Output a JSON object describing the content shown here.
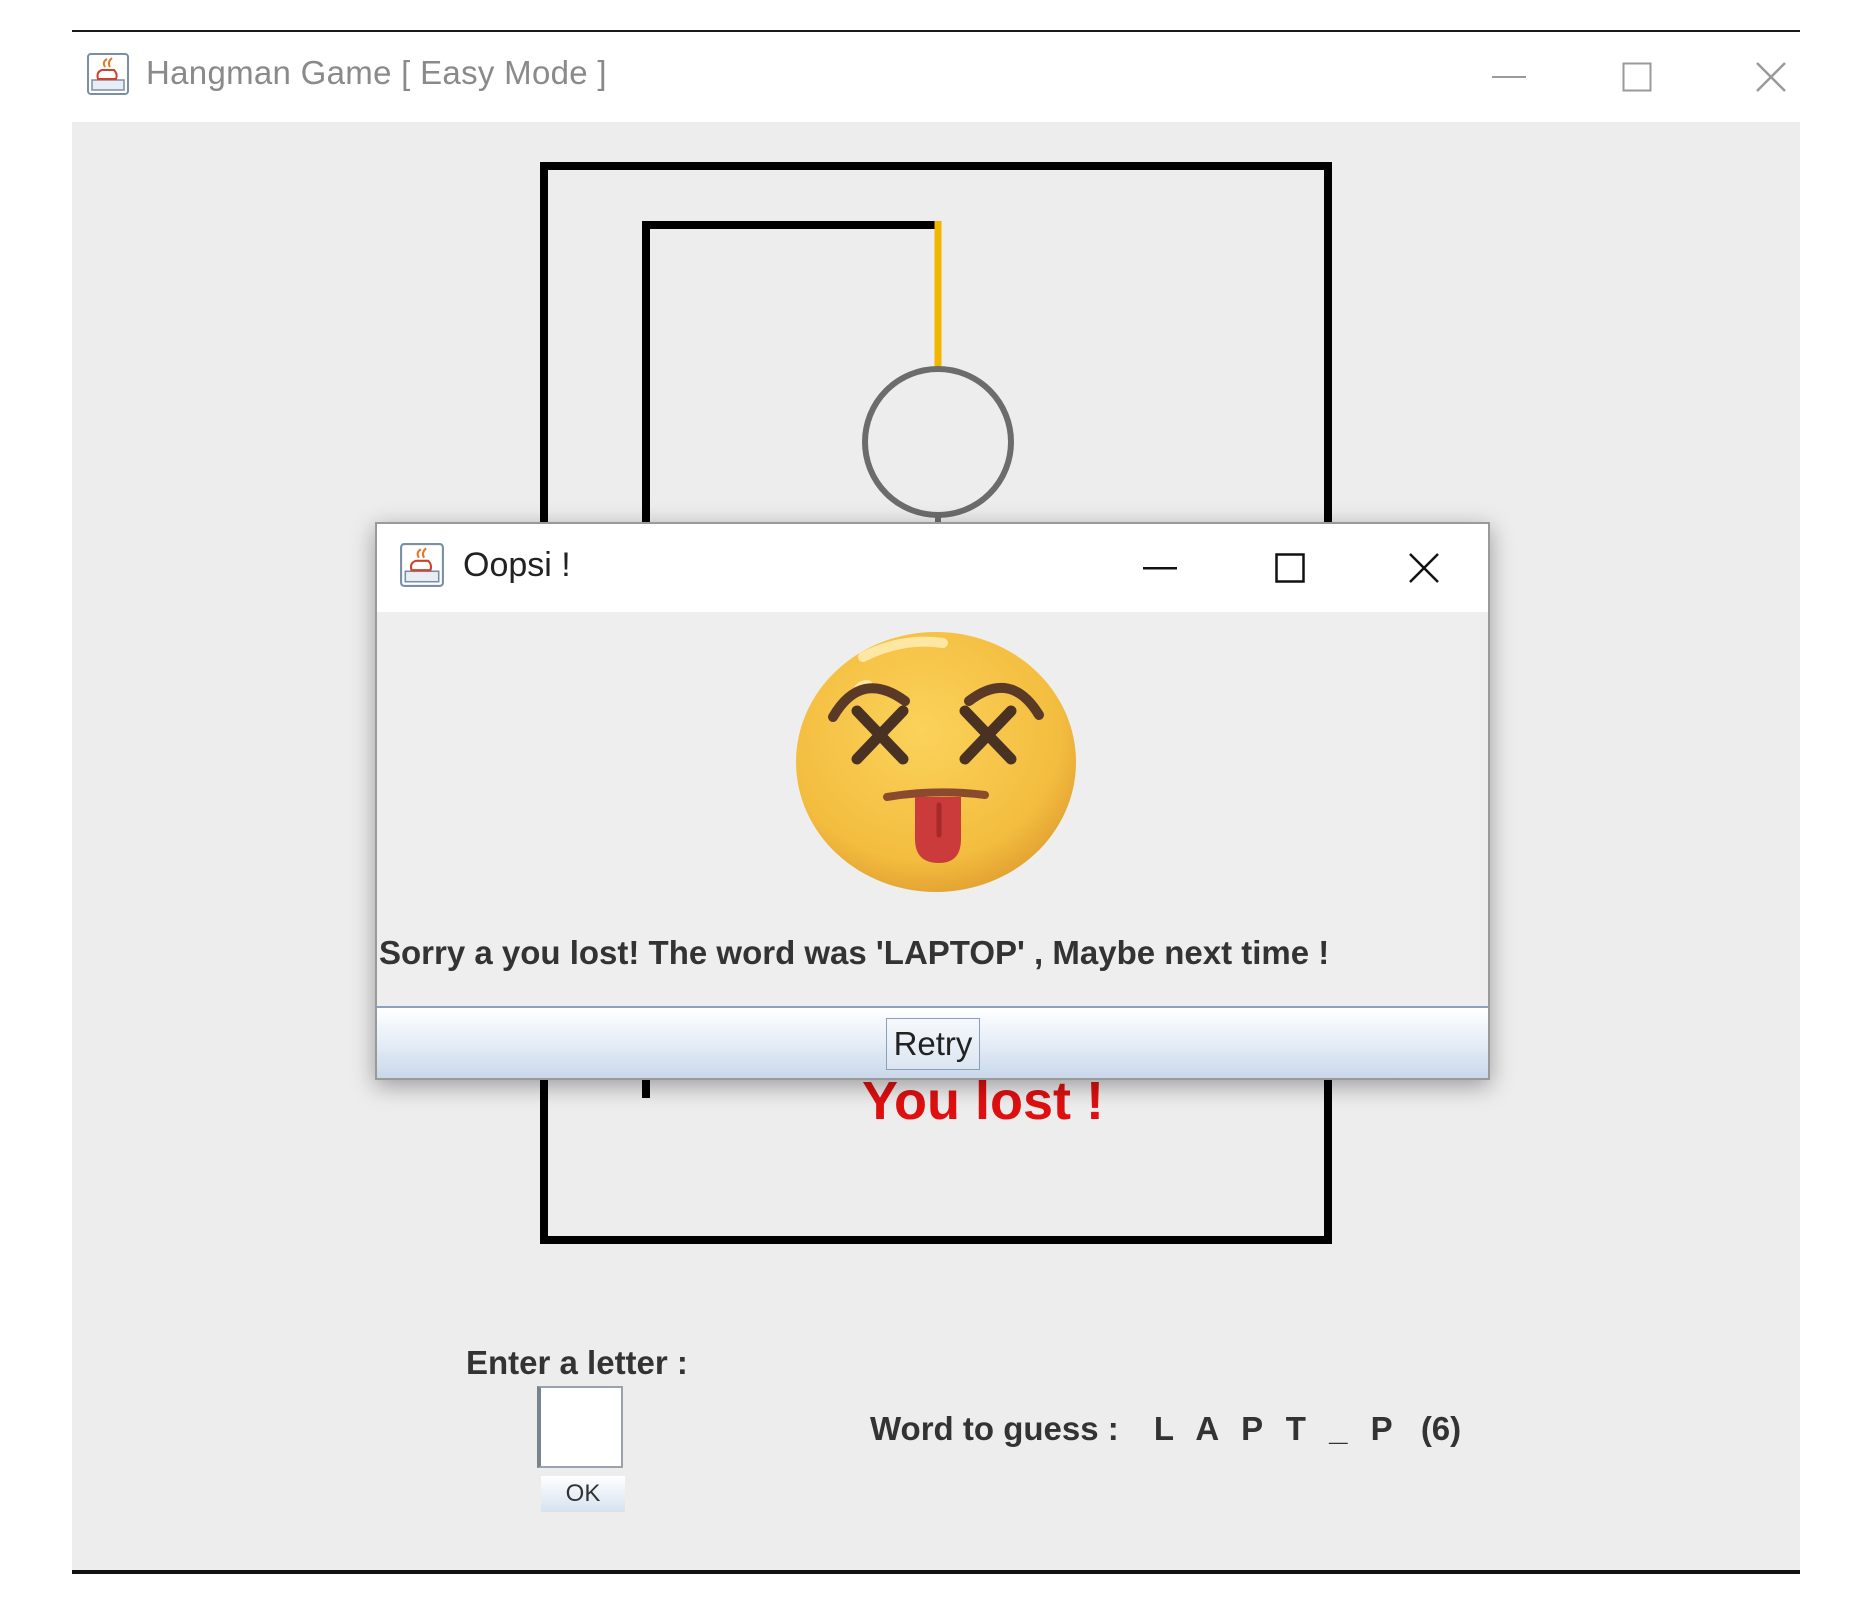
{
  "window": {
    "title": "Hangman Game [ Easy Mode ]",
    "icon": "java-cup-icon",
    "controls": [
      "minimize-icon",
      "maximize-icon",
      "close-icon"
    ]
  },
  "game": {
    "status_text": "You lost !",
    "status_color": "#e01010",
    "rope_color": "#f2b600"
  },
  "input": {
    "label": "Enter a letter :",
    "value": "",
    "ok_label": "OK"
  },
  "word": {
    "label": "Word to guess :",
    "value": "L A P T _ P",
    "count": "(6)"
  },
  "dialog": {
    "title": "Oopsi !",
    "icon": "java-cup-icon",
    "image": "dizzy-face-tongue-emoji",
    "message": "Sorry a you lost! The word was 'LAPTOP' , Maybe next time !",
    "retry_label": "Retry"
  }
}
